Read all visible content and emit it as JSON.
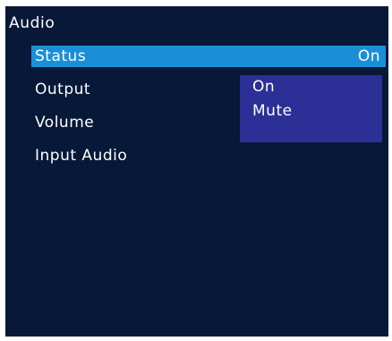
{
  "menu": {
    "title": "Audio",
    "items": [
      {
        "label": "Status",
        "value": "On",
        "selected": true
      },
      {
        "label": "Output"
      },
      {
        "label": "Volume"
      },
      {
        "label": "Input Audio"
      }
    ]
  },
  "dropdown": {
    "options": [
      "On",
      "Mute"
    ]
  },
  "colors": {
    "background": "#071838",
    "selection": "#1a8fd8",
    "dropdown": "#2b2f96",
    "text": "#ffffff"
  }
}
